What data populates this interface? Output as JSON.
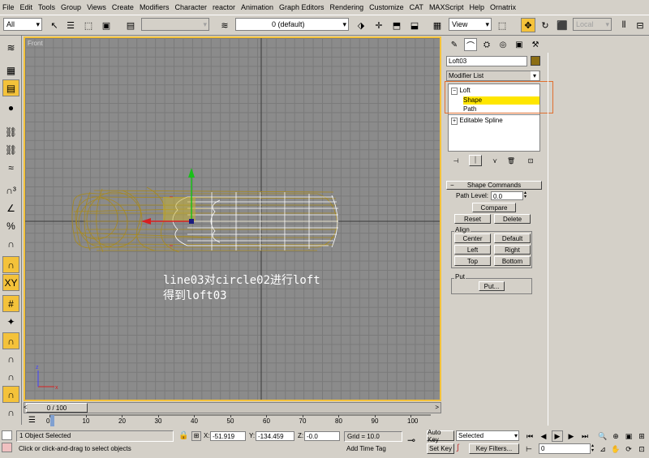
{
  "menu": [
    "File",
    "Edit",
    "Tools",
    "Group",
    "Views",
    "Create",
    "Modifiers",
    "Character",
    "reactor",
    "Animation",
    "Graph Editors",
    "Rendering",
    "Customize",
    "CAT",
    "MAXScript",
    "Help",
    "Ornatrix"
  ],
  "toolbar": {
    "selection_filter": "All",
    "layer": "0 (default)",
    "reference_coord": "View",
    "pivot_mode": "Local"
  },
  "viewport": {
    "label": "Front",
    "annotation_line1": "line03对circle02进行loft",
    "annotation_line2": "得到loft03",
    "colors": {
      "loft_wire": "#a88a1e",
      "path_wire": "#ffffff",
      "grid_bg": "#8b8b8b",
      "border": "#f4c23a"
    }
  },
  "command_panel": {
    "object_name": "Loft03",
    "object_color": "#8c6e14",
    "modifier_list": "Modifier List",
    "stack": {
      "root": "Loft",
      "shape": "Shape",
      "path": "Path",
      "editable_spline": "Editable Spline"
    },
    "rollout_title": "Shape Commands",
    "path_level_label": "Path Level:",
    "path_level_value": "0.0",
    "compare": "Compare",
    "reset": "Reset",
    "delete": "Delete",
    "align_label": "Align",
    "center": "Center",
    "default": "Default",
    "left": "Left",
    "right": "Right",
    "top": "Top",
    "bottom": "Bottom",
    "put_label": "Put",
    "put_button": "Put..."
  },
  "timeline": {
    "frame": "0 / 100",
    "ticks": [
      "0",
      "10",
      "20",
      "30",
      "40",
      "50",
      "60",
      "70",
      "80",
      "90",
      "100"
    ]
  },
  "status": {
    "selected": "1 Object Selected",
    "prompt": "Click or click-and-drag to select objects",
    "x_label": "X:",
    "x_value": "-51.919",
    "y_label": "Y:",
    "y_value": "-134.459",
    "z_label": "Z:",
    "z_value": "-0.0",
    "grid": "Grid = 10.0",
    "add_time_tag": "Add Time Tag",
    "auto_key": "Auto Key",
    "set_key": "Set Key",
    "key_mode": "Selected",
    "key_filters": "Key Filters...",
    "current_frame": "0"
  }
}
